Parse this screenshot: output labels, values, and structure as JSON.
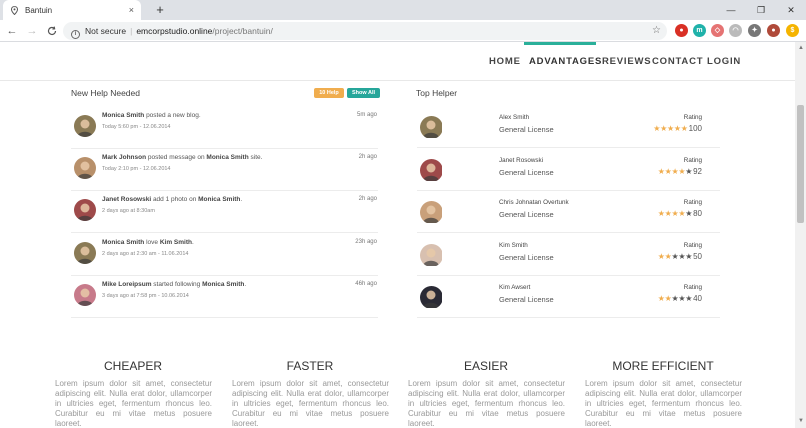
{
  "browser": {
    "tab_title": "Bantuin",
    "tab_close": "×",
    "new_tab": "+",
    "win_min": "—",
    "win_max": "❐",
    "win_close": "✕",
    "back": "←",
    "forward": "→",
    "reload": "C",
    "security": "Not secure",
    "separator": "|",
    "host": "emcorpstudio.online",
    "path": "/project/bantuin/",
    "star": "☆",
    "extensions": [
      {
        "label": "●",
        "color": "#d93025"
      },
      {
        "label": "m",
        "color": "#20b2aa"
      },
      {
        "label": "◇",
        "color": "#e57373"
      },
      {
        "label": "◠",
        "color": "#bbbbbb"
      },
      {
        "label": "✦",
        "color": "#777777"
      },
      {
        "label": "●",
        "color": "#b04a3a"
      },
      {
        "label": "$",
        "color": "#f5b400"
      }
    ]
  },
  "nav": {
    "items": [
      {
        "label": "HOME"
      },
      {
        "label": "ADVANTAGES",
        "active": true
      },
      {
        "label": "REVIEWS"
      },
      {
        "label": "CONTACT"
      },
      {
        "label": "LOGIN"
      }
    ],
    "accent": "#2bb09a"
  },
  "help_panel": {
    "title": "New Help Needed",
    "badge_count": "10 Help",
    "badge_all": "Show All",
    "badge_count_color": "#f0ad4e",
    "badge_all_color": "#26a69a",
    "feed": [
      {
        "actor": "Monica Smith",
        "action": " posted a new blog.",
        "target": "",
        "tail": "",
        "time": "Today 5:60 pm - 12.06.2014",
        "ago": "5m ago",
        "avatar_color": "#8a7a55"
      },
      {
        "actor": "Mark Johnson",
        "action": " posted message on ",
        "target": "Monica Smith",
        "tail": " site.",
        "time": "Today 2:10 pm - 12.06.2014",
        "ago": "2h ago",
        "avatar_color": "#b8906a"
      },
      {
        "actor": "Janet Rosowski",
        "action": " add 1 photo on ",
        "target": "Monica Smith",
        "tail": ".",
        "time": "2 days ago at 8:30am",
        "ago": "2h ago",
        "avatar_color": "#9e4a4a"
      },
      {
        "actor": "Monica Smith",
        "action": " love ",
        "target": "Kim Smith",
        "tail": ".",
        "time": "2 days ago at 2:30 am - 11.06.2014",
        "ago": "23h ago",
        "avatar_color": "#8a7a55"
      },
      {
        "actor": "Mike Loreipsum",
        "action": " started following ",
        "target": "Monica Smith",
        "tail": ".",
        "time": "3 days ago at 7:58 pm - 10.06.2014",
        "ago": "46h ago",
        "avatar_color": "#c77a8a"
      }
    ]
  },
  "top_helper": {
    "title": "Top Helper",
    "rating_label": "Rating",
    "star_on": "#f0ad4e",
    "star_off": "#555555",
    "helpers": [
      {
        "name": "Alex Smith",
        "license": "General License",
        "stars": 5,
        "score": "100",
        "avatar_color": "#8a7a55"
      },
      {
        "name": "Janet Rosowski",
        "license": "General License",
        "stars": 4,
        "score": "92",
        "avatar_color": "#9e4a4a"
      },
      {
        "name": "Chris Johnatan Overtunk",
        "license": "General License",
        "stars": 4,
        "score": "80",
        "avatar_color": "#c9a07a"
      },
      {
        "name": "Kim Smith",
        "license": "General License",
        "stars": 2,
        "score": "50",
        "avatar_color": "#d8c0b0"
      },
      {
        "name": "Kim Awsert",
        "license": "General License",
        "stars": 2,
        "score": "40",
        "avatar_color": "#2a2a35"
      }
    ]
  },
  "features": [
    {
      "title": "CHEAPER",
      "body": "Lorem ipsum dolor sit amet, consectetur adipiscing elit. Nulla erat dolor, ullamcorper in ultricies eget, fermentum rhoncus leo. Curabitur eu mi vitae metus posuere laoreet."
    },
    {
      "title": "FASTER",
      "body": "Lorem ipsum dolor sit amet, consectetur adipiscing elit. Nulla erat dolor, ullamcorper in ultricies eget, fermentum rhoncus leo. Curabitur eu mi vitae metus posuere laoreet."
    },
    {
      "title": "EASIER",
      "body": "Lorem ipsum dolor sit amet, consectetur adipiscing elit. Nulla erat dolor, ullamcorper in ultricies eget, fermentum rhoncus leo. Curabitur eu mi vitae metus posuere laoreet."
    },
    {
      "title": "MORE EFFICIENT",
      "body": "Lorem ipsum dolor sit amet, consectetur adipiscing elit. Nulla erat dolor, ullamcorper in ultricies eget, fermentum rhoncus leo. Curabitur eu mi vitae metus posuere laoreet."
    }
  ]
}
